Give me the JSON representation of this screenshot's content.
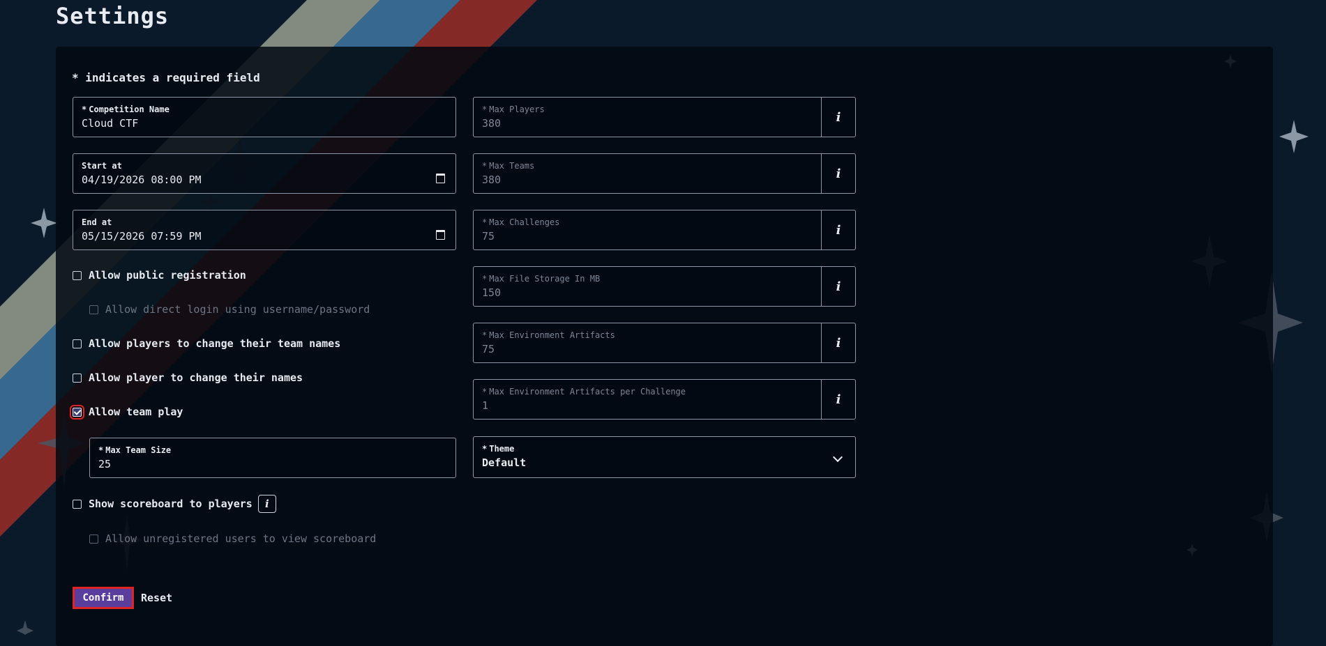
{
  "page": {
    "title": "Settings"
  },
  "form": {
    "required_note": "* indicates a required field",
    "competition_name": {
      "label": "Competition Name",
      "value": "Cloud CTF",
      "required": "*"
    },
    "start_at": {
      "label": "Start at",
      "value": "04/19/2026 08:00 PM"
    },
    "end_at": {
      "label": "End at",
      "value": "05/15/2026 07:59 PM"
    },
    "limits": [
      {
        "label": "Max Players",
        "value": "380"
      },
      {
        "label": "Max Teams",
        "value": "380"
      },
      {
        "label": "Max Challenges",
        "value": "75"
      },
      {
        "label": "Max File Storage In MB",
        "value": "150"
      },
      {
        "label": "Max Environment Artifacts",
        "value": "75"
      },
      {
        "label": "Max Environment Artifacts per Challenge",
        "value": "1"
      }
    ],
    "info_glyph": "i",
    "checkboxes": {
      "public_registration": {
        "label": "Allow public registration",
        "checked": false
      },
      "direct_login": {
        "label": "Allow direct login using username/password",
        "checked": false,
        "disabled": true
      },
      "change_team_names": {
        "label": "Allow players to change their team names",
        "checked": false
      },
      "change_names": {
        "label": "Allow player to change their names",
        "checked": false
      },
      "team_play": {
        "label": "Allow team play",
        "checked": true
      },
      "show_scoreboard": {
        "label": "Show scoreboard to players",
        "checked": false
      },
      "unregistered_scoreboard": {
        "label": "Allow unregistered users to view scoreboard",
        "checked": false,
        "disabled": true
      }
    },
    "max_team_size": {
      "label": "Max Team Size",
      "value": "25"
    },
    "theme": {
      "label": "Theme",
      "value": "Default"
    },
    "confirm_label": "Confirm",
    "reset_label": "Reset"
  },
  "colors": {
    "background": "#0b1a2b",
    "panel": "#020912",
    "accent": "#5a3e9e",
    "focus_outline": "#e02424",
    "stripe_beige": "#8a9084",
    "stripe_blue": "#3a6d96",
    "stripe_red": "#8b2a26"
  },
  "icons": [
    "calendar-icon",
    "info-icon",
    "chevron-down-icon",
    "checkmark-icon",
    "sparkle-icon"
  ]
}
